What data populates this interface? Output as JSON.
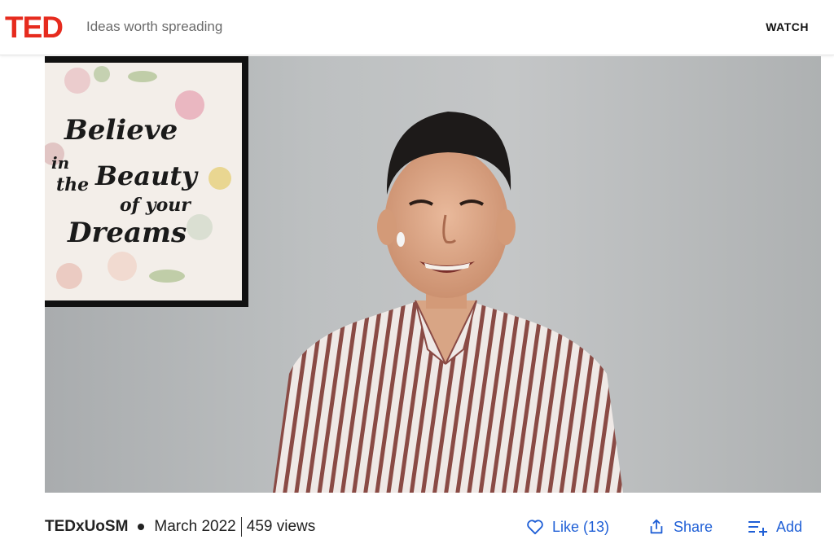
{
  "header": {
    "logo": "TED",
    "tagline": "Ideas worth spreading",
    "nav_watch": "WATCH"
  },
  "video": {
    "sign_lines": [
      "Believe",
      "in",
      "the",
      "Beauty",
      "of your",
      "Dreams"
    ]
  },
  "meta": {
    "channel": "TEDxUoSM",
    "date": "March 2022",
    "views": "459 views"
  },
  "actions": {
    "like": "Like (13)",
    "share": "Share",
    "add": "Add"
  },
  "colors": {
    "brand_red": "#e62b1e",
    "action_blue": "#1f5fd6"
  },
  "icons": [
    "heart-icon",
    "share-icon",
    "add-to-list-icon"
  ]
}
